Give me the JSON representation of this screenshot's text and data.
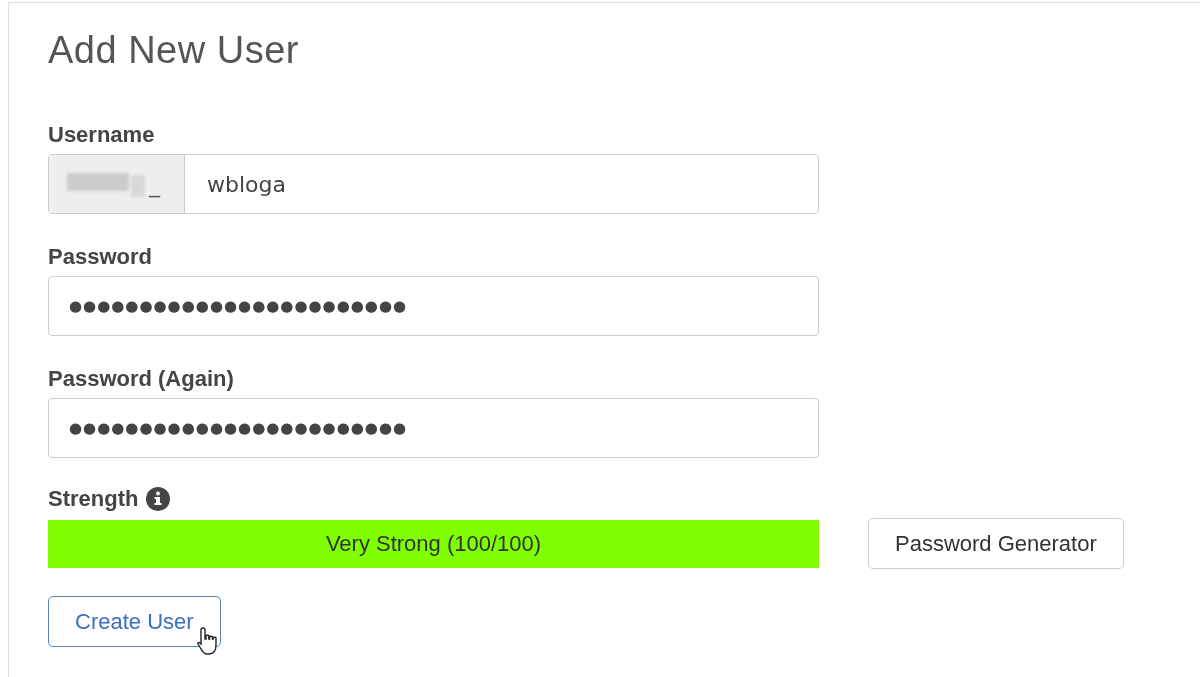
{
  "title": "Add New User",
  "fields": [
    {
      "kind": "prefixed",
      "label": "Username",
      "prefix": "_",
      "value": "wbloga"
    },
    {
      "kind": "password",
      "label": "Password",
      "value": "●●●●●●●●●●●●●●●●●●●●●●●●"
    },
    {
      "kind": "password",
      "label": "Password (Again)",
      "value": "●●●●●●●●●●●●●●●●●●●●●●●●"
    }
  ],
  "strength": {
    "label": "Strength",
    "level": 1,
    "reading": "Very Strong (100/100)"
  },
  "generator_button": "Password Generator",
  "create_button": "Create User"
}
